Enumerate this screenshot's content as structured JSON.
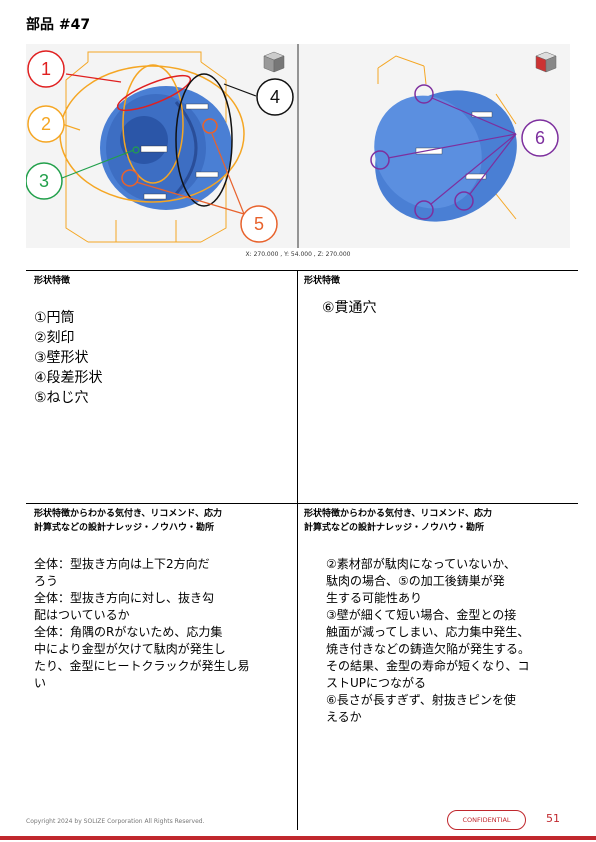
{
  "title": "部品 #47",
  "viewer": {
    "coords": "X: 270.000 , Y: 54.000 , Z: 270.000",
    "callouts": [
      "1",
      "2",
      "3",
      "4",
      "5",
      "6"
    ],
    "colors": {
      "red": "#e02020",
      "orange": "#f5a623",
      "green": "#22a04b",
      "black": "#111111",
      "coral": "#e8622c",
      "purple": "#7d2f9e",
      "part": "#4a7fd4"
    }
  },
  "sections": {
    "left_top_header": "形状特徴",
    "left_top_items": [
      "①円筒",
      "②刻印",
      "③壁形状",
      "④段差形状",
      "⑤ねじ穴"
    ],
    "right_top_header": "形状特徴",
    "right_top_items": [
      "⑥貫通穴"
    ],
    "left_bottom_header": [
      "形状特徴からわかる気付き、リコメンド、応力",
      "計算式などの設計ナレッジ・ノウハウ・勘所"
    ],
    "left_bottom_text": "全体：型抜き方向は上下2方向だ\nろう\n全体：型抜き方向に対し、抜き勾\n配はついているか\n全体：角隅のRがないため、応力集\n中により金型が欠けて駄肉が発生し\nたり、金型にヒートクラックが発生し易\nい",
    "right_bottom_header": [
      "形状特徴からわかる気付き、リコメンド、応力",
      "計算式などの設計ナレッジ・ノウハウ・勘所"
    ],
    "right_bottom_text": "②素材部が駄肉になっていないか、\n駄肉の場合、⑤の加工後鋳巣が発\n生する可能性あり\n③壁が細くて短い場合、金型との接\n触面が減ってしまい、応力集中発生、\n焼き付きなどの鋳造欠陥が発生する。\nその結果、金型の寿命が短くなり、コ\nストUPにつながる\n⑥長さが長すぎず、射抜きピンを使\nえるか"
  },
  "footer": {
    "copyright": "Copyright 2024 by SOLIZE Corporation All Rights Reserved.",
    "confidential": "CONFIDENTIAL",
    "page": "51"
  }
}
